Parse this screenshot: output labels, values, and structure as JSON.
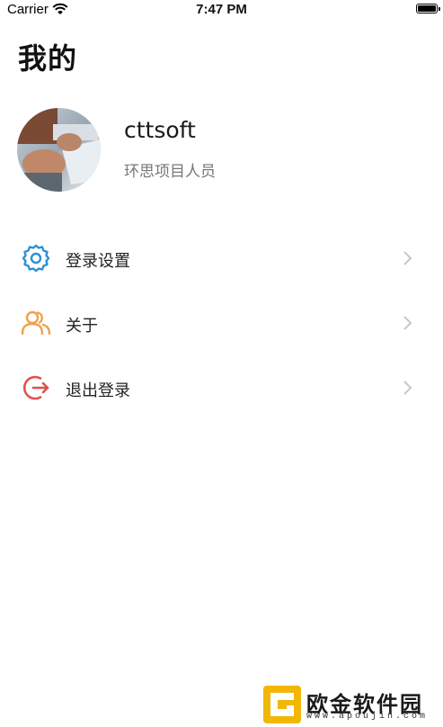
{
  "status_bar": {
    "carrier": "Carrier",
    "time": "7:47 PM"
  },
  "page": {
    "title": "我的"
  },
  "profile": {
    "username": "cttsoft",
    "role": "环思项目人员"
  },
  "menu": {
    "items": [
      {
        "label": "登录设置",
        "icon": "gear-icon",
        "icon_color": "#2b8fd6"
      },
      {
        "label": "关于",
        "icon": "users-icon",
        "icon_color": "#f0a04b"
      },
      {
        "label": "退出登录",
        "icon": "logout-icon",
        "icon_color": "#e2504a"
      }
    ]
  },
  "watermark": {
    "name": "欧金软件园",
    "url": "www.apoujin.com"
  }
}
